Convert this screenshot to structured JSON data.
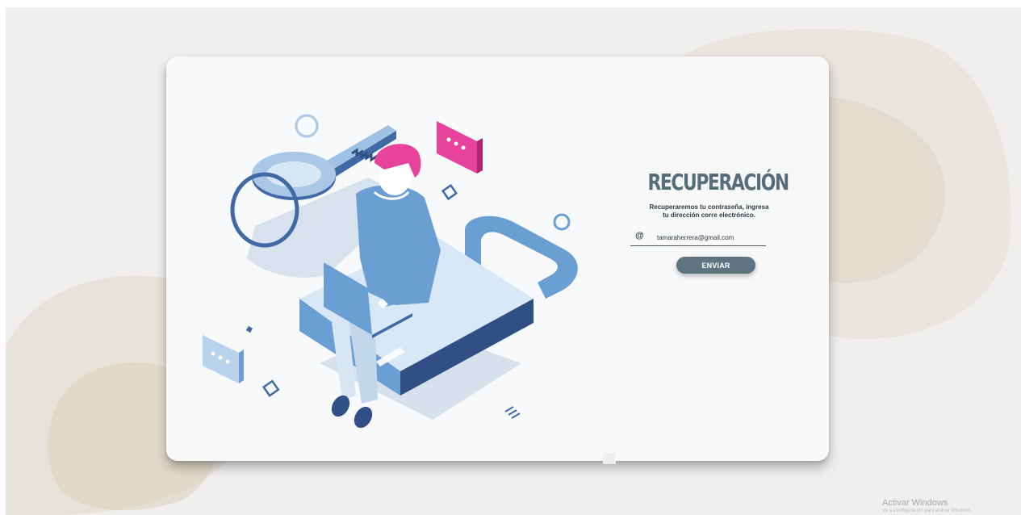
{
  "form": {
    "title": "RECUPERACIÓN",
    "subtitle_line1": "Recuperaremos tu contraseña, ingresa",
    "subtitle_line2": "tu dirección corre electrónico.",
    "email_icon": "@",
    "email_value": "tamaraherrera@gmail.com",
    "submit_label": "ENVIAR"
  },
  "watermark": {
    "line1": "Activar Windows",
    "line2": "Ve a Configuración para activar Windows."
  },
  "icons": {
    "at": "at-icon",
    "illustration": "password-recovery-illustration"
  },
  "colors": {
    "title": "#566d7b",
    "button": "#5f7480",
    "accent_pink": "#e8439a",
    "illustration_blue": "#6a9fd4"
  }
}
